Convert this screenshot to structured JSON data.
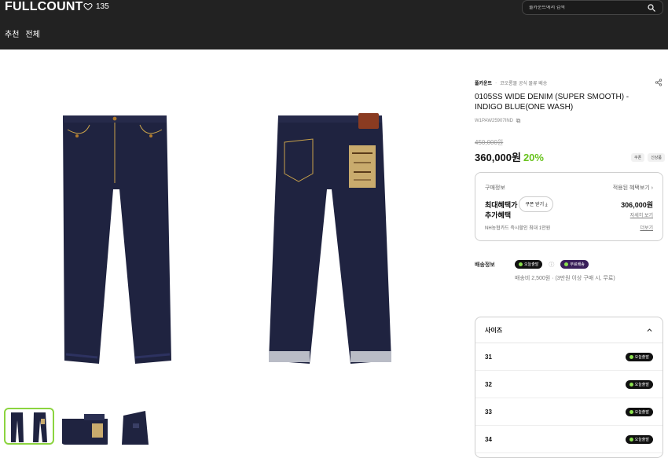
{
  "header": {
    "brand": "FULLCOUNT",
    "likes": "135",
    "tabs": [
      "추천",
      "전체"
    ],
    "search_placeholder": "풀카운트에서 검색"
  },
  "product": {
    "seller": "풀카운트",
    "seller_note": "코오롱몰 공식 물류 배송",
    "title": "0105SS WIDE DENIM (SUPER SMOOTH) - INDIGO BLUE(ONE WASH)",
    "code": "W1PAW25907IND",
    "original_price": "450,000원",
    "price": "360,000원",
    "discount": "20%",
    "badges": [
      "쿠폰",
      "신상품"
    ]
  },
  "buy_info": {
    "label": "구매정보",
    "benefit_link": "적용된 혜택보기",
    "max_benefit_label": "최대혜택가",
    "coupon_button": "쿠폰 받기",
    "max_benefit_price": "306,000원",
    "extra_label": "추가혜택",
    "detail_link": "자세히 보기",
    "card_note": "NH농협카드 즉시할인 최대 1만원",
    "more_link": "더보기"
  },
  "shipping": {
    "label": "배송정보",
    "badge_today": "오늘출발",
    "badge_free": "무료배송",
    "fee": "배송비 2,500원 · (3만원 이상 구매 시, 무료)"
  },
  "sizes": {
    "label": "사이즈",
    "items": [
      {
        "size": "31",
        "badge": "오늘출발"
      },
      {
        "size": "32",
        "badge": "오늘출발"
      },
      {
        "size": "33",
        "badge": "오늘출발"
      },
      {
        "size": "34",
        "badge": "오늘출발"
      }
    ]
  },
  "colors": {
    "header_bg": "#222222",
    "denim": "#1f2340",
    "discount_green": "#69c31e",
    "thumb_active": "#8bd43f"
  }
}
